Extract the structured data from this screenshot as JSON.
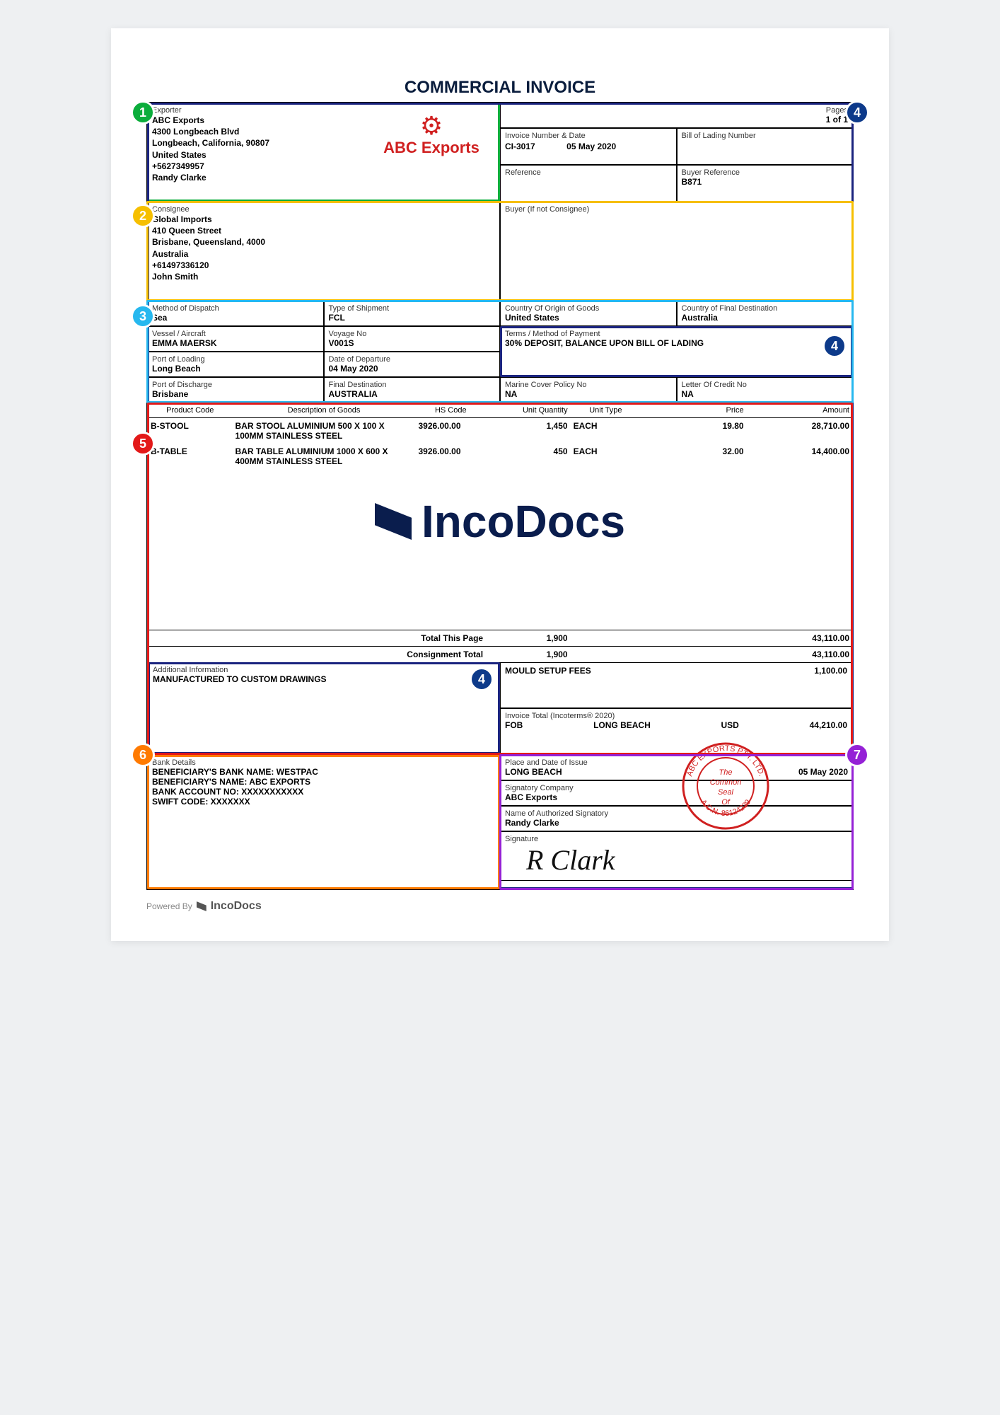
{
  "title": "COMMERCIAL INVOICE",
  "pages_label": "Pages",
  "pages_value": "1 of 1",
  "exporter": {
    "label": "Exporter",
    "name": "ABC Exports",
    "street": "4300 Longbeach Blvd",
    "city": "Longbeach, California, 90807",
    "country": "United States",
    "phone": "+5627349957",
    "contact": "Randy Clarke",
    "logo_text": "ABC Exports"
  },
  "consignee": {
    "label": "Consignee",
    "name": "Global Imports",
    "street": "410 Queen Street",
    "city": "Brisbane, Queensland, 4000",
    "country": "Australia",
    "phone": "+61497336120",
    "contact": "John Smith"
  },
  "buyer_label": "Buyer (If not Consignee)",
  "invoice_no_label": "Invoice Number & Date",
  "invoice_no": "CI-3017",
  "invoice_date": "05 May 2020",
  "bol_label": "Bill of Lading Number",
  "ref_label": "Reference",
  "buyer_ref_label": "Buyer Reference",
  "buyer_ref": "B871",
  "dispatch_label": "Method of Dispatch",
  "dispatch": "Sea",
  "shiptype_label": "Type of Shipment",
  "shiptype": "FCL",
  "coo_label": "Country Of Origin of Goods",
  "coo": "United States",
  "cfd_label": "Country of Final Destination",
  "cfd": "Australia",
  "vessel_label": "Vessel / Aircraft",
  "vessel": "EMMA MAERSK",
  "voyage_label": "Voyage No",
  "voyage": "V001S",
  "terms_label": "Terms / Method of Payment",
  "terms": "30% DEPOSIT, BALANCE UPON BILL OF LADING",
  "pol_label": "Port of Loading",
  "pol": "Long Beach",
  "dod_label": "Date of Departure",
  "dod": "04 May 2020",
  "pod_label": "Port of Discharge",
  "pod": "Brisbane",
  "fdest_label": "Final Destination",
  "fdest": "AUSTRALIA",
  "marine_label": "Marine Cover Policy No",
  "marine": "NA",
  "lc_label": "Letter Of Credit No",
  "lc": "NA",
  "cols": {
    "code": "Product Code",
    "desc": "Description of Goods",
    "hs": "HS Code",
    "qty": "Unit Quantity",
    "utype": "Unit Type",
    "price": "Price",
    "amount": "Amount"
  },
  "items": [
    {
      "code": "B-STOOL",
      "desc": "BAR STOOL ALUMINIUM 500 X 100 X 100MM STAINLESS STEEL",
      "hs": "3926.00.00",
      "qty": "1,450",
      "utype": "EACH",
      "price": "19.80",
      "amount": "28,710.00"
    },
    {
      "code": "B-TABLE",
      "desc": "BAR TABLE ALUMINIUM 1000 X 600 X 400MM STAINLESS STEEL",
      "hs": "3926.00.00",
      "qty": "450",
      "utype": "EACH",
      "price": "32.00",
      "amount": "14,400.00"
    }
  ],
  "watermark": "IncoDocs",
  "total_page_label": "Total This Page",
  "total_page_qty": "1,900",
  "total_page_amt": "43,110.00",
  "cons_total_label": "Consignment Total",
  "cons_total_qty": "1,900",
  "cons_total_amt": "43,110.00",
  "addl_label": "Additional Information",
  "addl_info": "MANUFACTURED TO CUSTOM DRAWINGS",
  "fee_label": "MOULD SETUP FEES",
  "fee_amt": "1,100.00",
  "inv_total_label": "Invoice Total (Incoterms® 2020)",
  "incoterm": "FOB",
  "inco_place": "LONG BEACH",
  "currency": "USD",
  "inv_total_amt": "44,210.00",
  "bank": {
    "label": "Bank Details",
    "l1": "BENEFICIARY'S BANK NAME:  WESTPAC",
    "l2": "BENEFICIARY'S NAME:  ABC EXPORTS",
    "l3": "BANK ACCOUNT NO: XXXXXXXXXXX",
    "l4": "SWIFT CODE: XXXXXXX"
  },
  "issue_label": "Place and Date of Issue",
  "issue_place": "LONG BEACH",
  "issue_date": "05 May 2020",
  "sigco_label": "Signatory Company",
  "sigco": "ABC Exports",
  "signame_label": "Name of Authorized Signatory",
  "signame": "Randy  Clarke",
  "sig_label": "Signature",
  "signature": "R Clark",
  "stamp_top": "ABC EXPORTS PTY. LTD.",
  "stamp_mid1": "The",
  "stamp_mid2": "Common",
  "stamp_mid3": "Seal",
  "stamp_mid4": "Of",
  "stamp_bottom": "A.C.N. 86124239",
  "footer_prefix": "Powered By",
  "footer_brand": "IncoDocs",
  "badges": {
    "1": "1",
    "2": "2",
    "3": "3",
    "4a": "4",
    "4b": "4",
    "4c": "4",
    "5": "5",
    "6": "6",
    "7": "7"
  }
}
